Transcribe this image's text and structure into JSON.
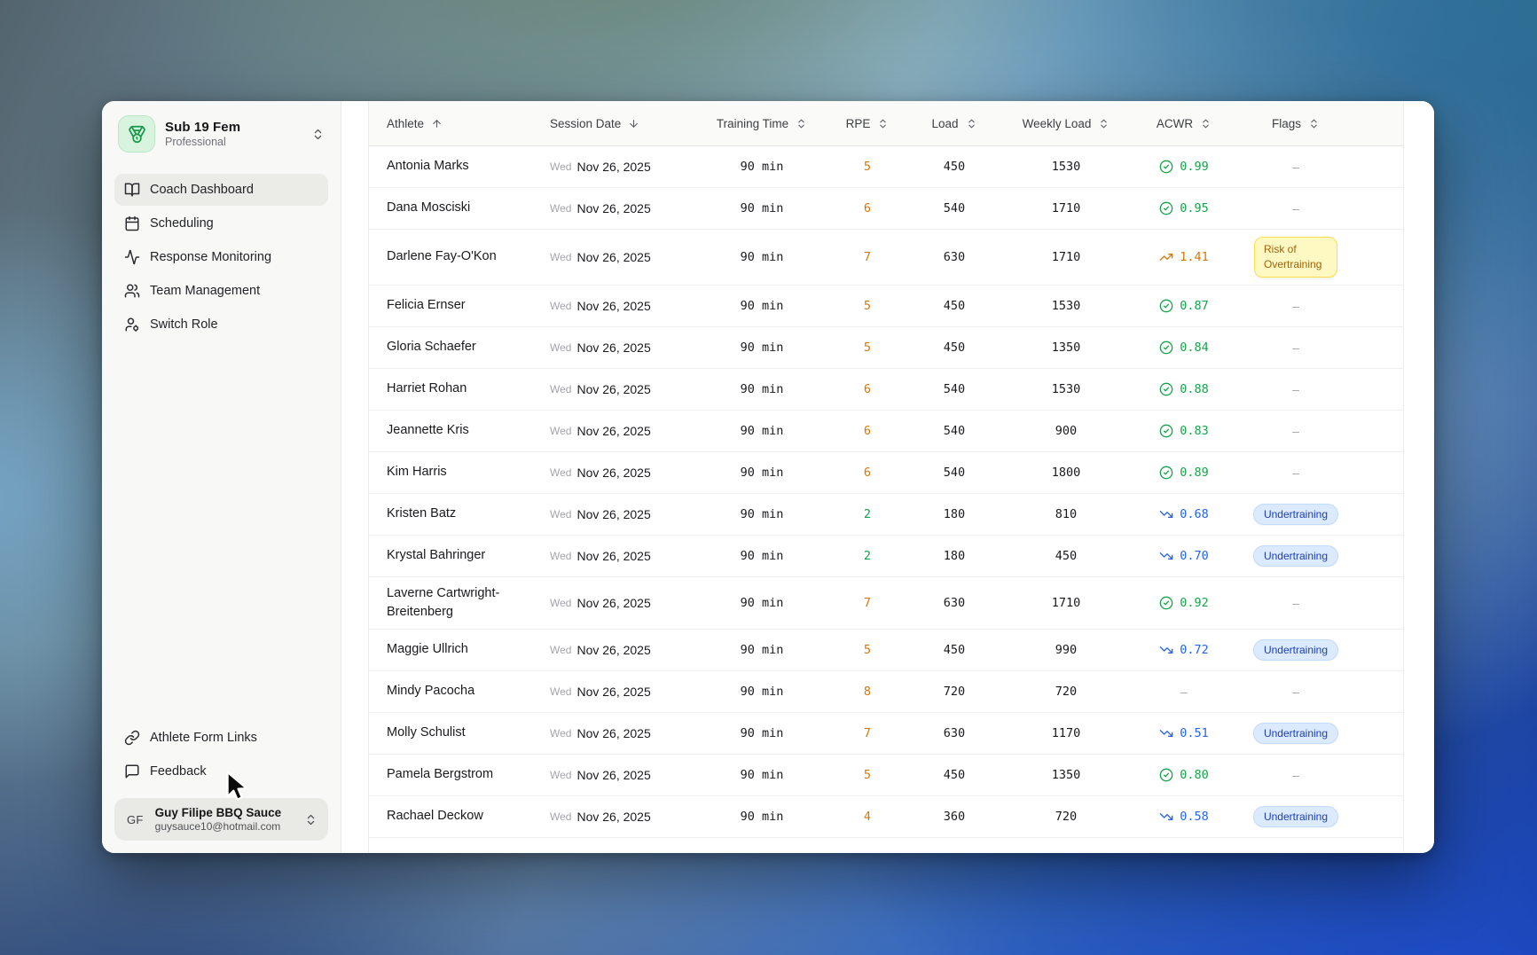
{
  "sidebar": {
    "team": {
      "name": "Sub 19 Fem",
      "plan": "Professional",
      "icon": "medal"
    },
    "nav": [
      {
        "label": "Coach Dashboard",
        "icon": "book-open",
        "active": true
      },
      {
        "label": "Scheduling",
        "icon": "calendar",
        "active": false
      },
      {
        "label": "Response Monitoring",
        "icon": "activity",
        "active": false
      },
      {
        "label": "Team Management",
        "icon": "users",
        "active": false
      },
      {
        "label": "Switch Role",
        "icon": "user-switch",
        "active": false
      }
    ],
    "footer_links": [
      {
        "label": "Athlete Form Links",
        "icon": "link"
      },
      {
        "label": "Feedback",
        "icon": "message-square"
      }
    ],
    "user": {
      "initials": "GF",
      "name": "Guy Filipe BBQ Sauce",
      "email": "guysauce10@hotmail.com"
    }
  },
  "table": {
    "dash": "–",
    "columns": [
      {
        "label": "Athlete",
        "sort": "asc"
      },
      {
        "label": "Session Date",
        "sort": "desc"
      },
      {
        "label": "Training Time",
        "sort": "both"
      },
      {
        "label": "RPE",
        "sort": "both"
      },
      {
        "label": "Load",
        "sort": "both"
      },
      {
        "label": "Weekly Load",
        "sort": "both"
      },
      {
        "label": "ACWR",
        "sort": "both"
      },
      {
        "label": "Flags",
        "sort": "both"
      }
    ],
    "flag_labels": {
      "overtraining": "Risk of Overtraining",
      "undertraining": "Undertraining"
    },
    "rows": [
      {
        "athlete": "Antonia Marks",
        "day": "Wed",
        "date": "Nov 26, 2025",
        "time": "90 min",
        "rpe": "5",
        "rpe_tone": "amber",
        "load": "450",
        "weekly_load": "1530",
        "acwr": "0.99",
        "acwr_state": "ok",
        "flag": "none"
      },
      {
        "athlete": "Dana Mosciski",
        "day": "Wed",
        "date": "Nov 26, 2025",
        "time": "90 min",
        "rpe": "6",
        "rpe_tone": "amber",
        "load": "540",
        "weekly_load": "1710",
        "acwr": "0.95",
        "acwr_state": "ok",
        "flag": "none"
      },
      {
        "athlete": "Darlene Fay-O'Kon",
        "day": "Wed",
        "date": "Nov 26, 2025",
        "time": "90 min",
        "rpe": "7",
        "rpe_tone": "amber",
        "load": "630",
        "weekly_load": "1710",
        "acwr": "1.41",
        "acwr_state": "high",
        "flag": "overtraining"
      },
      {
        "athlete": "Felicia Ernser",
        "day": "Wed",
        "date": "Nov 26, 2025",
        "time": "90 min",
        "rpe": "5",
        "rpe_tone": "amber",
        "load": "450",
        "weekly_load": "1530",
        "acwr": "0.87",
        "acwr_state": "ok",
        "flag": "none"
      },
      {
        "athlete": "Gloria Schaefer",
        "day": "Wed",
        "date": "Nov 26, 2025",
        "time": "90 min",
        "rpe": "5",
        "rpe_tone": "amber",
        "load": "450",
        "weekly_load": "1350",
        "acwr": "0.84",
        "acwr_state": "ok",
        "flag": "none"
      },
      {
        "athlete": "Harriet Rohan",
        "day": "Wed",
        "date": "Nov 26, 2025",
        "time": "90 min",
        "rpe": "6",
        "rpe_tone": "amber",
        "load": "540",
        "weekly_load": "1530",
        "acwr": "0.88",
        "acwr_state": "ok",
        "flag": "none"
      },
      {
        "athlete": "Jeannette Kris",
        "day": "Wed",
        "date": "Nov 26, 2025",
        "time": "90 min",
        "rpe": "6",
        "rpe_tone": "amber",
        "load": "540",
        "weekly_load": "900",
        "acwr": "0.83",
        "acwr_state": "ok",
        "flag": "none"
      },
      {
        "athlete": "Kim Harris",
        "day": "Wed",
        "date": "Nov 26, 2025",
        "time": "90 min",
        "rpe": "6",
        "rpe_tone": "amber",
        "load": "540",
        "weekly_load": "1800",
        "acwr": "0.89",
        "acwr_state": "ok",
        "flag": "none"
      },
      {
        "athlete": "Kristen Batz",
        "day": "Wed",
        "date": "Nov 26, 2025",
        "time": "90 min",
        "rpe": "2",
        "rpe_tone": "green",
        "load": "180",
        "weekly_load": "810",
        "acwr": "0.68",
        "acwr_state": "low",
        "flag": "undertraining"
      },
      {
        "athlete": "Krystal Bahringer",
        "day": "Wed",
        "date": "Nov 26, 2025",
        "time": "90 min",
        "rpe": "2",
        "rpe_tone": "green",
        "load": "180",
        "weekly_load": "450",
        "acwr": "0.70",
        "acwr_state": "low",
        "flag": "undertraining"
      },
      {
        "athlete": "Laverne Cartwright-Breitenberg",
        "day": "Wed",
        "date": "Nov 26, 2025",
        "time": "90 min",
        "rpe": "7",
        "rpe_tone": "amber",
        "load": "630",
        "weekly_load": "1710",
        "acwr": "0.92",
        "acwr_state": "ok",
        "flag": "none"
      },
      {
        "athlete": "Maggie Ullrich",
        "day": "Wed",
        "date": "Nov 26, 2025",
        "time": "90 min",
        "rpe": "5",
        "rpe_tone": "amber",
        "load": "450",
        "weekly_load": "990",
        "acwr": "0.72",
        "acwr_state": "low",
        "flag": "undertraining"
      },
      {
        "athlete": "Mindy Pacocha",
        "day": "Wed",
        "date": "Nov 26, 2025",
        "time": "90 min",
        "rpe": "8",
        "rpe_tone": "amber",
        "load": "720",
        "weekly_load": "720",
        "acwr": "",
        "acwr_state": "none",
        "flag": "none"
      },
      {
        "athlete": "Molly Schulist",
        "day": "Wed",
        "date": "Nov 26, 2025",
        "time": "90 min",
        "rpe": "7",
        "rpe_tone": "amber",
        "load": "630",
        "weekly_load": "1170",
        "acwr": "0.51",
        "acwr_state": "low",
        "flag": "undertraining"
      },
      {
        "athlete": "Pamela Bergstrom",
        "day": "Wed",
        "date": "Nov 26, 2025",
        "time": "90 min",
        "rpe": "5",
        "rpe_tone": "amber",
        "load": "450",
        "weekly_load": "1350",
        "acwr": "0.80",
        "acwr_state": "ok",
        "flag": "none"
      },
      {
        "athlete": "Rachael Deckow",
        "day": "Wed",
        "date": "Nov 26, 2025",
        "time": "90 min",
        "rpe": "4",
        "rpe_tone": "amber",
        "load": "360",
        "weekly_load": "720",
        "acwr": "0.58",
        "acwr_state": "low",
        "flag": "undertraining"
      }
    ]
  },
  "colors": {
    "amber": "#d97706",
    "green": "#16a34a",
    "blue": "#2563eb",
    "flag_yellow_bg": "#fef9c3",
    "flag_yellow_border": "#fde047",
    "flag_yellow_text": "#a16207",
    "flag_blue_bg": "#dbeafe",
    "flag_blue_border": "#bfdbfe",
    "flag_blue_text": "#1e40af"
  }
}
